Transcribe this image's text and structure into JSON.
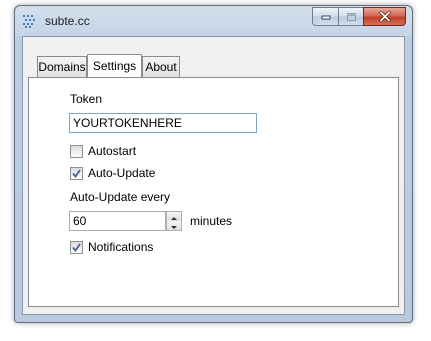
{
  "window": {
    "title": "subte.cc"
  },
  "tabs": [
    {
      "label": "Domains",
      "active": false
    },
    {
      "label": "Settings",
      "active": true
    },
    {
      "label": "About",
      "active": false
    }
  ],
  "settings": {
    "token_label": "Token",
    "token_value": "YOURTOKENHERE",
    "autostart_label": "Autostart",
    "autostart_checked": false,
    "autoupdate_label": "Auto-Update",
    "autoupdate_checked": true,
    "interval_label": "Auto-Update every",
    "interval_value": "60",
    "interval_unit": "minutes",
    "notifications_label": "Notifications",
    "notifications_checked": true
  },
  "icons": {
    "app": "dotted-lines-icon",
    "minimize": "minimize-icon",
    "maximize": "maximize-icon",
    "close": "close-icon",
    "spin_up": "chevron-up-icon",
    "spin_down": "chevron-down-icon",
    "check": "checkmark-icon"
  },
  "colors": {
    "title_bar": "#c5d4e6",
    "close_button": "#c7462f",
    "panel_bg": "#ffffff",
    "textbox_border": "#7ea6c9"
  }
}
